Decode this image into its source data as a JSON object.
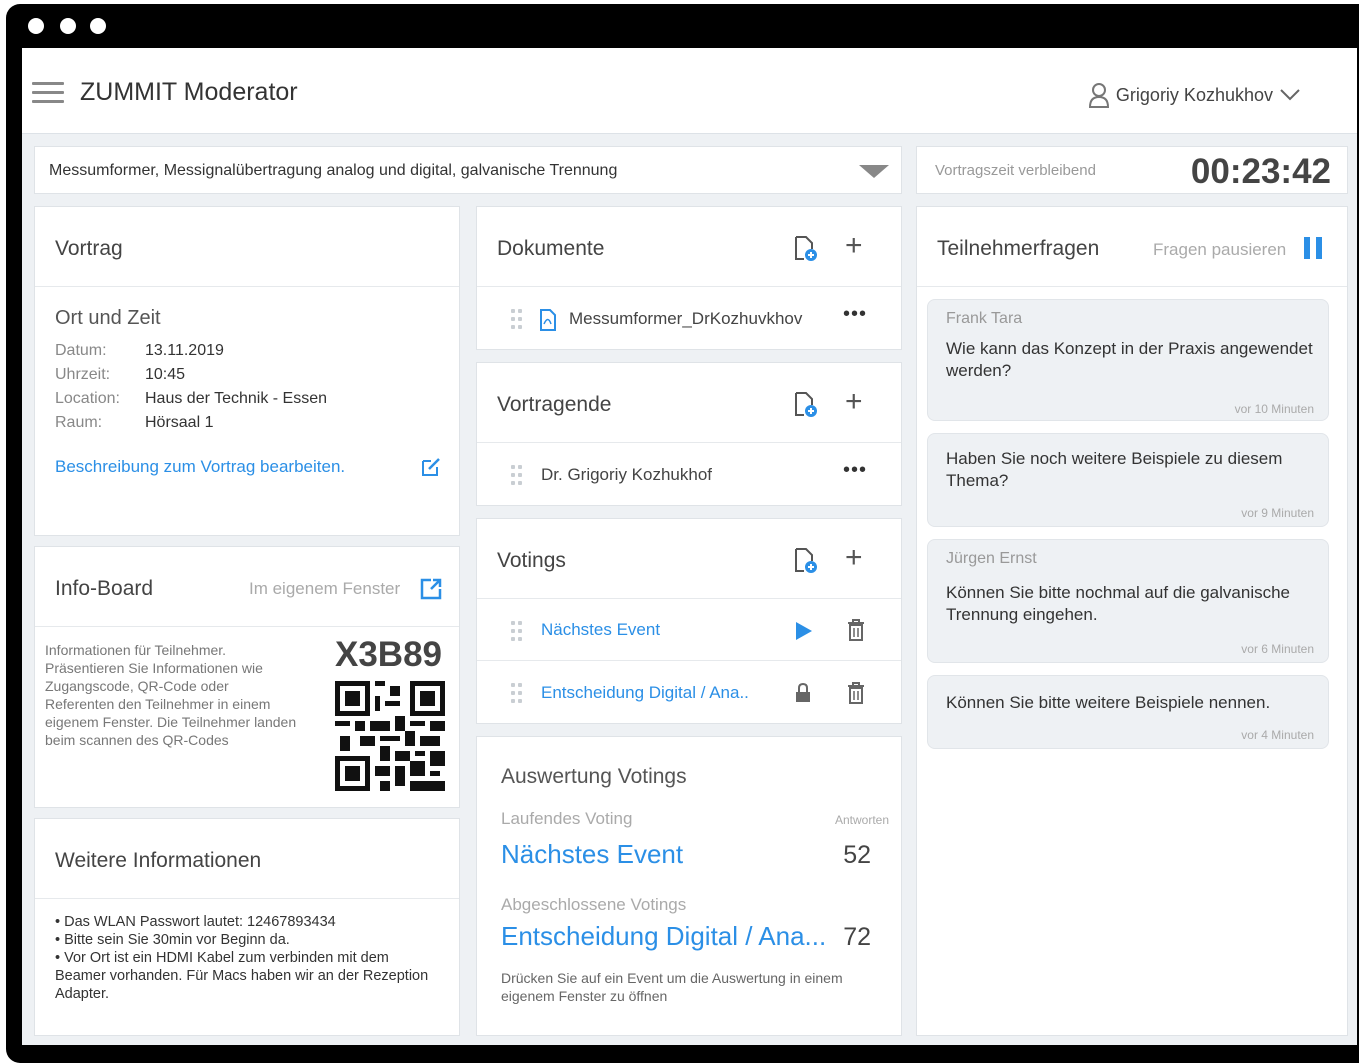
{
  "app": {
    "title": "ZUMMIT Moderator",
    "user_name": "Grigoriy Kozhukhov"
  },
  "topbar": {
    "topic": "Messumformer, Messignalübertragung analog und digital, galvanische Trennung",
    "time_label": "Vortragszeit verbleibend",
    "time_value": "00:23:42"
  },
  "vortrag": {
    "title": "Vortrag",
    "subtitle": "Ort und Zeit",
    "fields": [
      {
        "label": "Datum:",
        "value": "13.11.2019"
      },
      {
        "label": "Uhrzeit:",
        "value": "10:45"
      },
      {
        "label": "Location:",
        "value": "Haus der Technik - Essen"
      },
      {
        "label": "Raum:",
        "value": "Hörsaal 1"
      }
    ],
    "edit_link": "Beschreibung zum Vortrag bearbeiten."
  },
  "infoboard": {
    "title": "Info-Board",
    "window_link": "Im eigenem Fenster",
    "text": "Informationen für Teilnehmer. Präsentieren Sie Informationen wie Zugangscode, QR-Code oder Referenten den Teilnehmer in einem eigenem Fenster. Die Teilnehmer landen beim scannen des QR-Codes",
    "code": "X3B89"
  },
  "weitere": {
    "title": "Weitere Informationen",
    "items": [
      "• Das WLAN Passwort lautet: 12467893434",
      "• Bitte sein Sie 30min vor Beginn da.",
      "• Vor Ort ist ein HDMI Kabel zum verbinden mit dem Beamer vorhanden. Für Macs haben wir an der Rezeption Adapter."
    ]
  },
  "dokumente": {
    "title": "Dokumente",
    "items": [
      "Messumformer_DrKozhuvkhov"
    ]
  },
  "vortragende": {
    "title": "Vortragende",
    "items": [
      "Dr. Grigoriy Kozhukhof"
    ]
  },
  "votings": {
    "title": "Votings",
    "items": [
      "Nächstes Event",
      "Entscheidung Digital / Ana.."
    ]
  },
  "auswertung": {
    "title": "Auswertung Votings",
    "running_label": "Laufendes Voting",
    "answers_label": "Antworten",
    "running_name": "Nächstes Event",
    "running_count": "52",
    "done_label": "Abgeschlossene Votings",
    "done_name": "Entscheidung Digital / Ana...",
    "done_count": "72",
    "hint": "Drücken Sie auf ein Event um die Auswertung in einem eigenem Fenster zu öffnen"
  },
  "fragen": {
    "title": "Teilnehmerfragen",
    "pause_label": "Fragen pausieren",
    "questions": [
      {
        "author": "Frank Tara",
        "text": "Wie kann das Konzept in der Praxis angewendet werden?",
        "time": "vor 10 Minuten"
      },
      {
        "author": "",
        "text": "Haben Sie noch weitere Beispiele zu diesem Thema?",
        "time": "vor 9 Minuten"
      },
      {
        "author": "Jürgen Ernst",
        "text": "Können Sie bitte nochmal auf die galvanische Trennung eingehen.",
        "time": "vor 6 Minuten"
      },
      {
        "author": "",
        "text": "Können Sie bitte weitere Beispiele nennen.",
        "time": "vor 4 Minuten"
      }
    ]
  },
  "colors": {
    "accent": "#2b8fe6",
    "background": "#eef1f4"
  },
  "icons": [
    "hamburger-icon",
    "user-icon",
    "chevron-down-icon",
    "caret-down-icon",
    "file-add-icon",
    "plus-icon",
    "pdf-icon",
    "more-icon",
    "play-icon",
    "trash-icon",
    "lock-icon",
    "edit-icon",
    "external-link-icon",
    "pause-icon",
    "drag-handle-icon",
    "qr-code"
  ]
}
